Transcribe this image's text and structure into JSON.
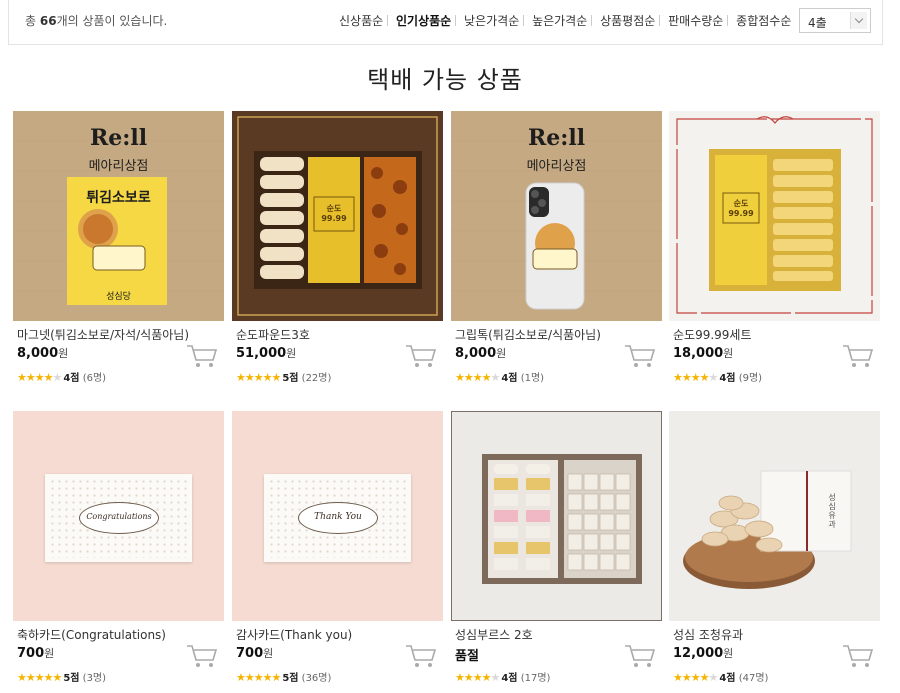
{
  "toolbar": {
    "count_prefix": "총 ",
    "count_value": "66",
    "count_suffix": "개의 상품이 있습니다.",
    "sort_options": [
      "신상품순",
      "인기상품순",
      "낮은가격순",
      "높은가격순",
      "상품평점순",
      "판매수량순",
      "종합점수순"
    ],
    "active_sort": "인기상품순",
    "columns_select": "4출"
  },
  "section_title": "택배 가능 상품",
  "colors": {
    "star": "#f5b400",
    "kraft": "#c5a983",
    "pink": "#f5dbd1",
    "yellow": "#f5d844"
  },
  "products": [
    {
      "name": "마그넷(튀김소보로/자석/식품아님)",
      "price": "8,000",
      "currency": "원",
      "score": "4점",
      "reviews": "(6명)",
      "stars": 4,
      "image_texts": [
        "Re:ll",
        "메아리상점",
        "튀김소보로",
        "성심당"
      ]
    },
    {
      "name": "순도파운드3호",
      "price": "51,000",
      "currency": "원",
      "score": "5점",
      "reviews": "(22명)",
      "stars": 5,
      "image_texts": [
        "순도",
        "99.99"
      ]
    },
    {
      "name": "그립톡(튀김소보로/식품아님)",
      "price": "8,000",
      "currency": "원",
      "score": "4점",
      "reviews": "(1명)",
      "stars": 4,
      "image_texts": [
        "Re:ll",
        "메아리상점"
      ]
    },
    {
      "name": "순도99.99세트",
      "price": "18,000",
      "currency": "원",
      "score": "4점",
      "reviews": "(9명)",
      "stars": 4,
      "image_texts": [
        "순도",
        "99.99"
      ]
    },
    {
      "name": "축하카드(Congratulations)",
      "price": "700",
      "currency": "원",
      "score": "5점",
      "reviews": "(3명)",
      "stars": 5,
      "image_texts": [
        "Congratulations"
      ]
    },
    {
      "name": "감사카드(Thank you)",
      "price": "700",
      "currency": "원",
      "score": "5점",
      "reviews": "(36명)",
      "stars": 5,
      "image_texts": [
        "Thank You"
      ]
    },
    {
      "name": "성심부르스 2호",
      "price": "",
      "currency": "",
      "soldout": "품절",
      "score": "4점",
      "reviews": "(17명)",
      "stars": 4,
      "image_texts": []
    },
    {
      "name": "성심 조청유과",
      "price": "12,000",
      "currency": "원",
      "score": "4점",
      "reviews": "(47명)",
      "stars": 4,
      "image_texts": [
        "성심유과"
      ]
    }
  ]
}
